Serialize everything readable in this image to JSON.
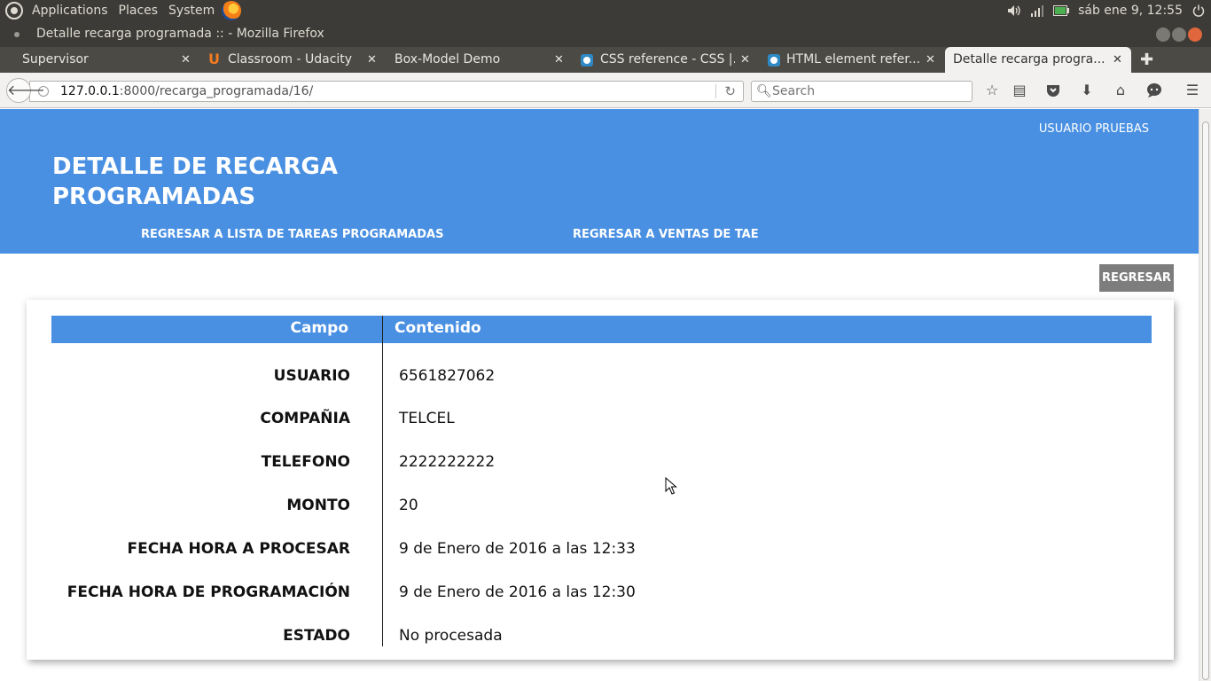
{
  "top_panel": {
    "menus": [
      "Applications",
      "Places",
      "System"
    ],
    "clock": "sáb ene  9, 12:55"
  },
  "window": {
    "title": "Detalle recarga programada :: - Mozilla Firefox"
  },
  "tabs": [
    {
      "label": "Supervisor"
    },
    {
      "label": "Classroom - Udacity"
    },
    {
      "label": "Box-Model Demo"
    },
    {
      "label": "CSS reference - CSS |..."
    },
    {
      "label": "HTML element refer..."
    },
    {
      "label": "Detalle recarga progra..."
    }
  ],
  "nav": {
    "url_host": "127.0.0.1",
    "url_rest": ":8000/recarga_programada/16/",
    "search_placeholder": "Search"
  },
  "page": {
    "user_link": "USUARIO PRUEBAS",
    "title": "DETALLE DE RECARGA PROGRAMADAS",
    "nav_links": [
      "REGRESAR A LISTA DE TAREAS PROGRAMADAS",
      "REGRESAR A VENTAS DE TAE"
    ],
    "back_button": "REGRESAR",
    "table": {
      "headers": [
        "Campo",
        "Contenido"
      ],
      "rows": [
        {
          "field": "USUARIO",
          "value": "6561827062"
        },
        {
          "field": "COMPAÑIA",
          "value": "TELCEL"
        },
        {
          "field": "TELEFONO",
          "value": "2222222222"
        },
        {
          "field": "MONTO",
          "value": "20"
        },
        {
          "field": "FECHA HORA A PROCESAR",
          "value": "9 de Enero de 2016 a las 12:33"
        },
        {
          "field": "FECHA HORA DE PROGRAMACIÓN",
          "value": "9 de Enero de 2016 a las 12:30"
        },
        {
          "field": "ESTADO",
          "value": "No procesada"
        }
      ]
    }
  },
  "colors": {
    "header_blue": "#4a90e2",
    "button_gray": "#7d7d7d",
    "ubuntu_panel": "#3c3b37"
  }
}
